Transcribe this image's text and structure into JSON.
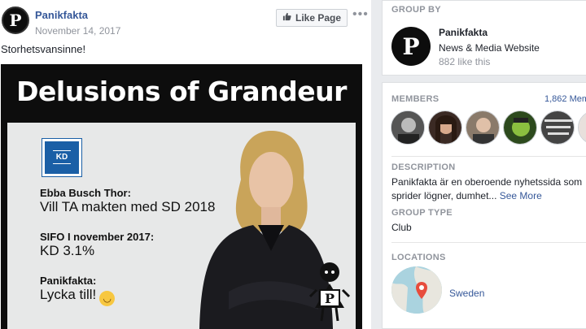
{
  "post": {
    "page_name": "Panikfakta",
    "date": "November 14, 2017",
    "like_button": "Like Page",
    "more_icon": "more-icon",
    "text": "Storhetsvansinne!",
    "image": {
      "title": "Delusions of Grandeur",
      "logo_text": "KD",
      "lines": [
        {
          "label": "Ebba Busch Thor:",
          "value": "Vill TA makten med SD 2018"
        },
        {
          "label": "SIFO I november 2017:",
          "value": "KD 3.1%"
        },
        {
          "label": "Panikfakta:",
          "value": "Lycka till!"
        }
      ]
    }
  },
  "sidebar": {
    "group_by": {
      "heading": "Group by",
      "name": "Panikfakta",
      "category": "News & Media Website",
      "likes": "882 like this"
    },
    "members": {
      "heading": "Members",
      "count": "1,862 Mem"
    },
    "description": {
      "heading": "Description",
      "line1": "Panikfakta är en oberoende nyhetssida som",
      "line2": "sprider lögner, dumhet...",
      "see_more": "See More"
    },
    "group_type": {
      "heading": "Group type",
      "value": "Club"
    },
    "locations": {
      "heading": "Locations",
      "value": "Sweden"
    }
  },
  "colors": {
    "link": "#365899",
    "muted": "#90949c",
    "kd_blue": "#1a5fa6"
  }
}
